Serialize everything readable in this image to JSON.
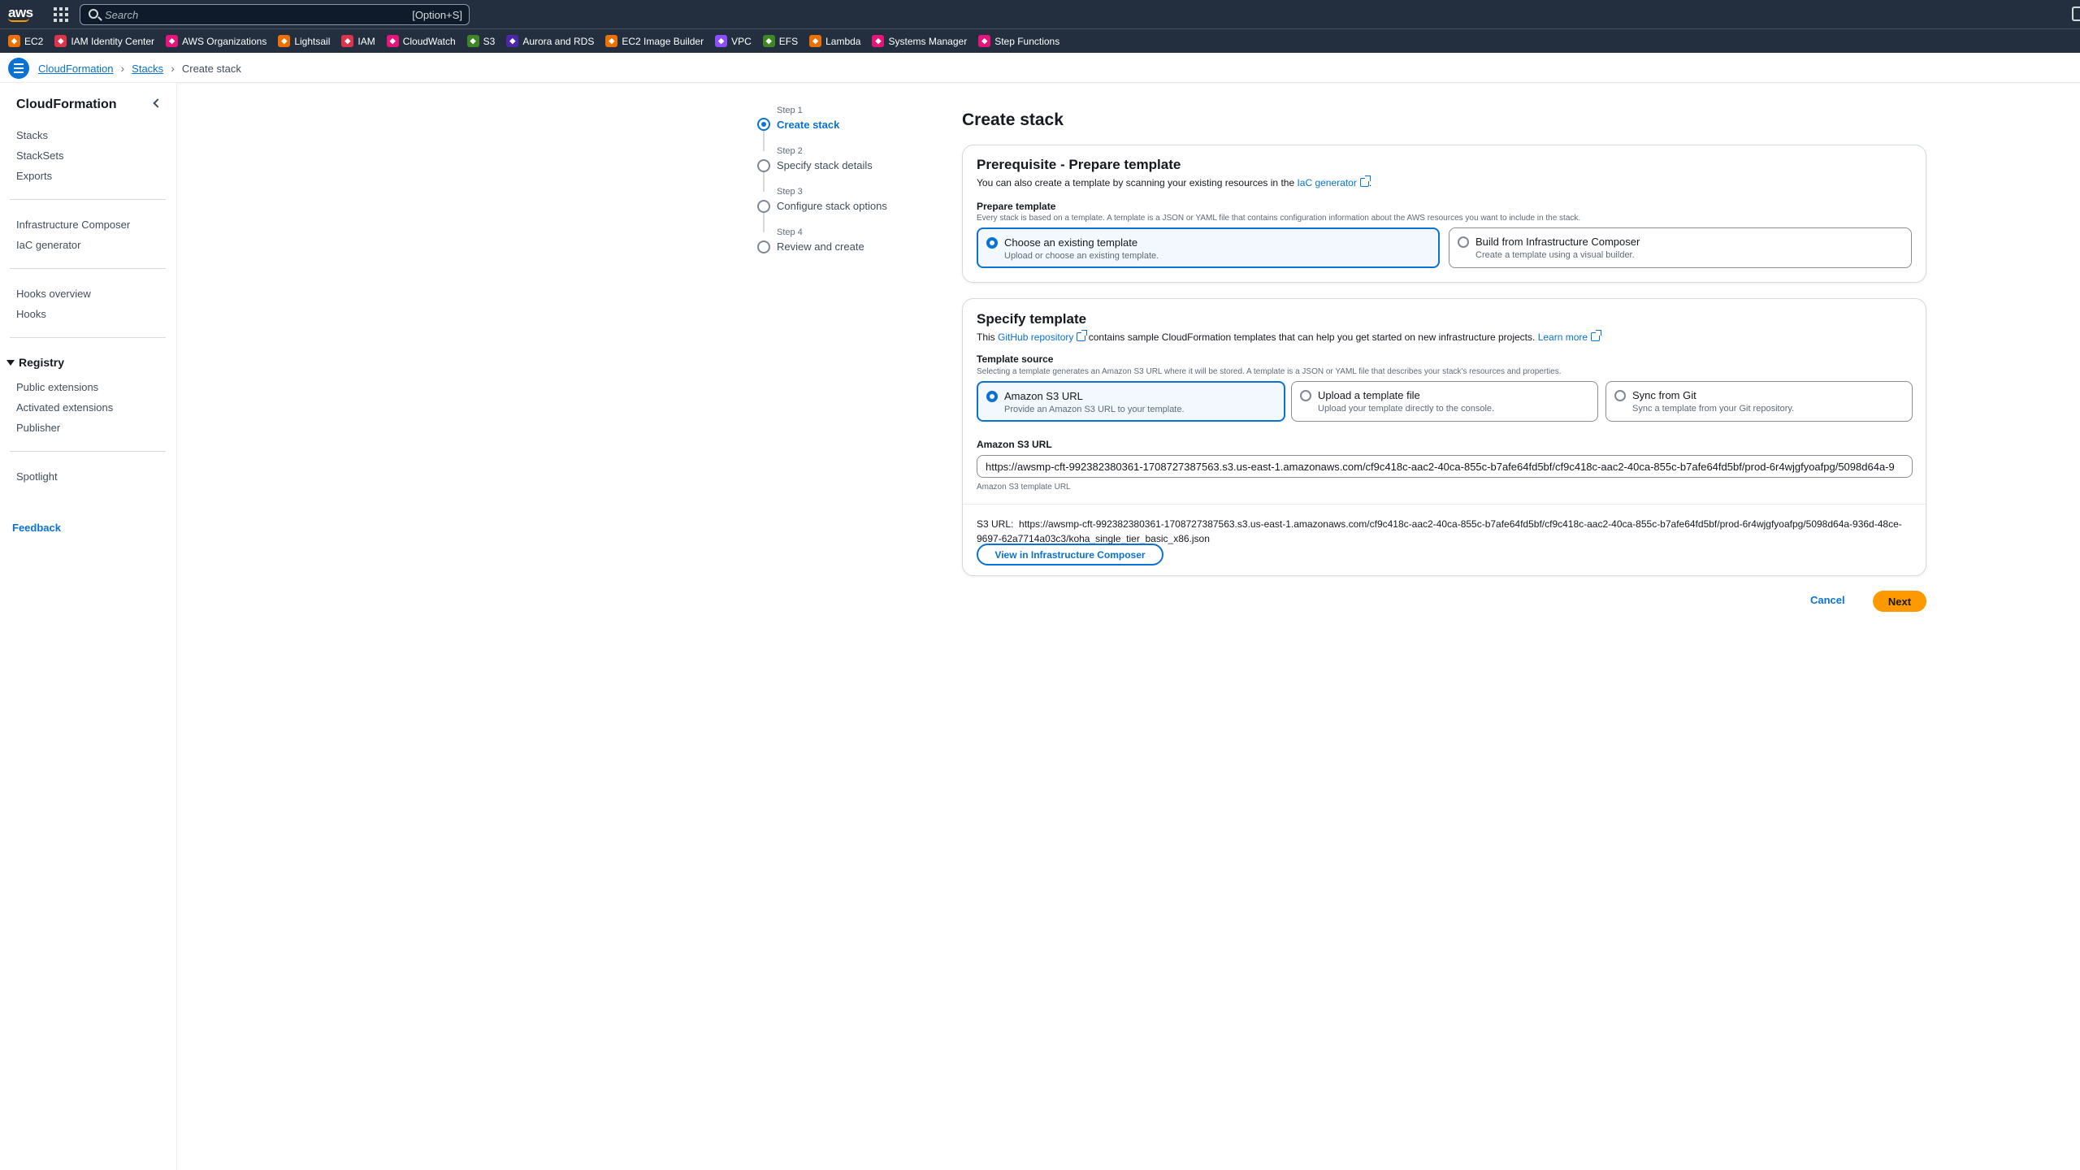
{
  "topnav": {
    "logo": "aws",
    "search_placeholder": "Search",
    "search_shortcut": "[Option+S]"
  },
  "favorites": [
    {
      "label": "EC2",
      "color": "#ed7100",
      "icon": "ec2-icon"
    },
    {
      "label": "IAM Identity Center",
      "color": "#dd344c",
      "icon": "iam-identity-center-icon"
    },
    {
      "label": "AWS Organizations",
      "color": "#e7157b",
      "icon": "organizations-icon"
    },
    {
      "label": "Lightsail",
      "color": "#ed7100",
      "icon": "lightsail-icon"
    },
    {
      "label": "IAM",
      "color": "#dd344c",
      "icon": "iam-icon"
    },
    {
      "label": "CloudWatch",
      "color": "#e7157b",
      "icon": "cloudwatch-icon"
    },
    {
      "label": "S3",
      "color": "#3f8624",
      "icon": "s3-icon"
    },
    {
      "label": "Aurora and RDS",
      "color": "#4d27aa",
      "icon": "rds-icon"
    },
    {
      "label": "EC2 Image Builder",
      "color": "#ed7100",
      "icon": "image-builder-icon"
    },
    {
      "label": "VPC",
      "color": "#8c4fff",
      "icon": "vpc-icon"
    },
    {
      "label": "EFS",
      "color": "#3f8624",
      "icon": "efs-icon"
    },
    {
      "label": "Lambda",
      "color": "#ed7100",
      "icon": "lambda-icon"
    },
    {
      "label": "Systems Manager",
      "color": "#e7157b",
      "icon": "systems-manager-icon"
    },
    {
      "label": "Step Functions",
      "color": "#e7157b",
      "icon": "step-functions-icon"
    }
  ],
  "breadcrumb": {
    "items": [
      "CloudFormation",
      "Stacks"
    ],
    "current": "Create stack"
  },
  "sidebar": {
    "title": "CloudFormation",
    "group1": [
      "Stacks",
      "StackSets",
      "Exports"
    ],
    "group2": [
      "Infrastructure Composer",
      "IaC generator"
    ],
    "group3": [
      "Hooks overview",
      "Hooks"
    ],
    "registry_label": "Registry",
    "registry_items": [
      "Public extensions",
      "Activated extensions",
      "Publisher"
    ],
    "group5": [
      "Spotlight"
    ],
    "feedback": "Feedback"
  },
  "steps": [
    {
      "num": "Step 1",
      "label": "Create stack",
      "active": true
    },
    {
      "num": "Step 2",
      "label": "Specify stack details",
      "active": false
    },
    {
      "num": "Step 3",
      "label": "Configure stack options",
      "active": false
    },
    {
      "num": "Step 4",
      "label": "Review and create",
      "active": false
    }
  ],
  "main": {
    "title": "Create stack",
    "prereq": {
      "heading": "Prerequisite - Prepare template",
      "desc_before": "You can also create a template by scanning your existing resources in the ",
      "desc_link": "IaC generator",
      "desc_after": ".",
      "label": "Prepare template",
      "hint": "Every stack is based on a template. A template is a JSON or YAML file that contains configuration information about the AWS resources you want to include in the stack.",
      "options": [
        {
          "title": "Choose an existing template",
          "desc": "Upload or choose an existing template.",
          "selected": true
        },
        {
          "title": "Build from Infrastructure Composer",
          "desc": "Create a template using a visual builder.",
          "selected": false
        }
      ]
    },
    "specify": {
      "heading": "Specify template",
      "desc_before": "This ",
      "desc_link": "GitHub repository",
      "desc_middle": " contains sample CloudFormation templates that can help you get started on new infrastructure projects. ",
      "desc_link2": "Learn more",
      "label": "Template source",
      "hint": "Selecting a template generates an Amazon S3 URL where it will be stored. A template is a JSON or YAML file that describes your stack's resources and properties.",
      "options": [
        {
          "title": "Amazon S3 URL",
          "desc": "Provide an Amazon S3 URL to your template.",
          "selected": true
        },
        {
          "title": "Upload a template file",
          "desc": "Upload your template directly to the console.",
          "selected": false
        },
        {
          "title": "Sync from Git",
          "desc": "Sync a template from your Git repository.",
          "selected": false
        }
      ],
      "url_label": "Amazon S3 URL",
      "url_value": "https://awsmp-cft-992382380361-1708727387563.s3.us-east-1.amazonaws.com/cf9c418c-aac2-40ca-855c-b7afe64fd5bf/cf9c418c-aac2-40ca-855c-b7afe64fd5bf/prod-6r4wjgfyoafpg/5098d64a-9",
      "url_hint": "Amazon S3 template URL",
      "s3_label": "S3 URL:",
      "s3_value": "https://awsmp-cft-992382380361-1708727387563.s3.us-east-1.amazonaws.com/cf9c418c-aac2-40ca-855c-b7afe64fd5bf/cf9c418c-aac2-40ca-855c-b7afe64fd5bf/prod-6r4wjgfyoafpg/5098d64a-936d-48ce-9697-62a7714a03c3/koha_single_tier_basic_x86.json",
      "view_button": "View in Infrastructure Composer"
    },
    "cancel": "Cancel",
    "next": "Next"
  }
}
